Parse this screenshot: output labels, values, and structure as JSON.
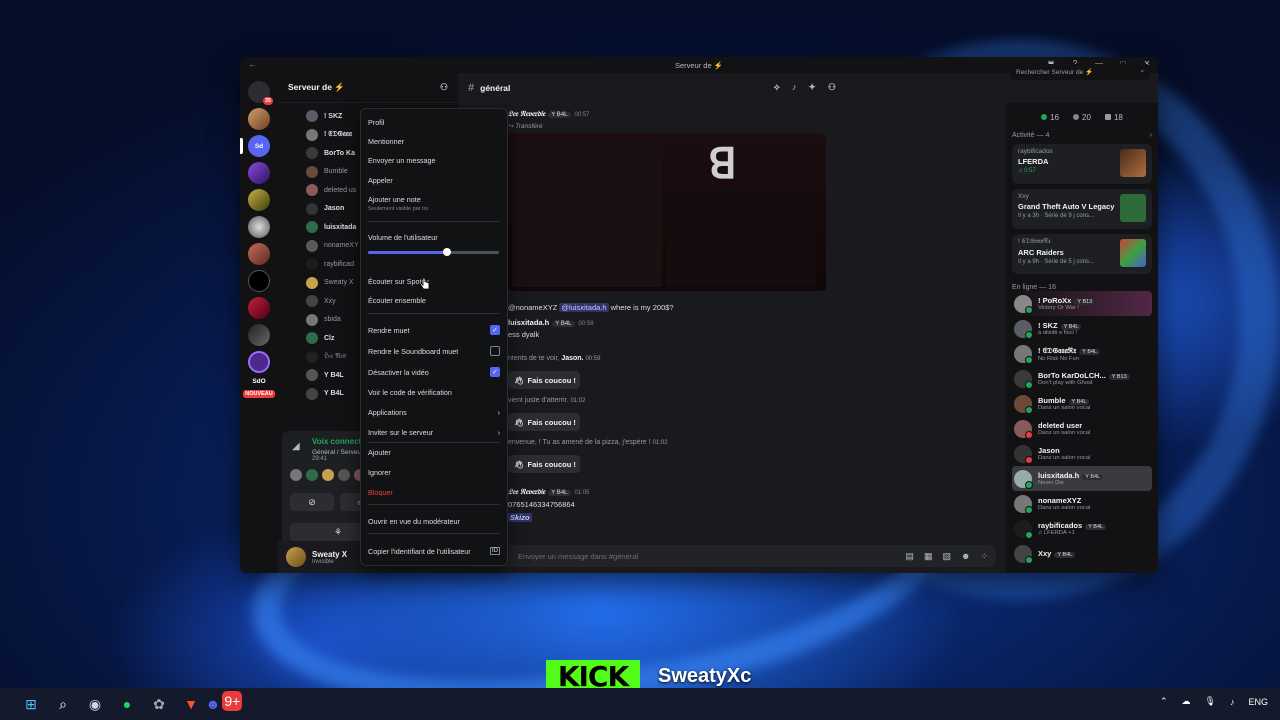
{
  "window": {
    "title": "Serveur de ⚡"
  },
  "server_rail": {
    "badges": [
      "35",
      "",
      "",
      "",
      "",
      "",
      "",
      "",
      "",
      "",
      "",
      ""
    ],
    "label": "SdO",
    "new": "NOUVEAU"
  },
  "sidebar": {
    "server_name": "Serveur de ⚡",
    "voice_users": [
      "! SKZ",
      "! 𝔈𝔇𝔊𝔞𝔞𝔞",
      "BorTo Ka",
      "Bumble",
      "deleted us",
      "Jason",
      "luisxitada",
      "nonameXY",
      "raybificad",
      "Sweaty X",
      "Xxy",
      "sbida",
      "Clz",
      "𝔏𝔢𝔢 𝔑𝔢𝔳",
      "Y B4L",
      "Y B4L"
    ],
    "voice_panel": {
      "title": "Voix connectée",
      "sub": "Général / Serveur de ⚡",
      "time": "29:41"
    },
    "user": {
      "name": "Sweaty X",
      "status": "Invisible"
    }
  },
  "chat": {
    "channel": "général",
    "search_placeholder": "Rechercher Serveur de ⚡",
    "messages": {
      "m1_author": "𝔏𝔢𝔢 𝔑𝔢𝔳𝔢𝔯𝔡𝔦𝔢",
      "m1_tag": "Y B4L",
      "m1_time": "00:57",
      "m1_forward": "↪ Transféré",
      "m2_prefix": "@nonameXYZ",
      "m2_mention": "@luisxitada.h",
      "m2_text": "where is my 200$?",
      "m3_author": "luisxitada.h",
      "m3_tag": "Y B4L",
      "m3_time": "00:58",
      "m3_text": "ess dyalk",
      "s1_text": "ntents de te voir,",
      "s1_name": "Jason.",
      "s1_time": "00:59",
      "wave": "Fais coucou !",
      "s2_text": "vient juste d'atterrir.",
      "s2_time": "01:02",
      "s3_text": "envenue, ! Tu as amené de la pizza, j'espère ! ",
      "s3_time": "01:02",
      "m4_author": "𝔏𝔢𝔢 𝔑𝔢𝔳𝔢𝔯𝔡𝔦𝔢",
      "m4_tag": "Y B4L",
      "m4_time": "01:05",
      "m4_text": "07651463347568​64",
      "m4_mention": "Skizo"
    },
    "composer_placeholder": "Envoyer un message dans #général"
  },
  "members": {
    "counts": [
      "16",
      "20",
      "18"
    ],
    "activity_title": "Activité — 4",
    "activities": [
      {
        "who": "raybificados",
        "game": "LFERDA",
        "meta": "♫ 0:57"
      },
      {
        "who": "Xxy",
        "game": "Grand Theft Auto V Legacy",
        "meta": "Il y a 3h · Série de 9 j cons..."
      },
      {
        "who": "! 𝔈𝔇𝔊𝔞𝔞𝔞ℜ𝔵",
        "game": "ARC Raiders",
        "meta": "Il y a 9h · Série de 5 j cons..."
      }
    ],
    "online_title": "En ligne — 16",
    "online": [
      {
        "name": "! PoRoXx",
        "tag": "Y B13",
        "status": "Victory Or War !"
      },
      {
        "name": "! SKZ",
        "tag": "Y B4L",
        "status": "à ɑlisitti e fisci !"
      },
      {
        "name": "! 𝔈𝔇𝔊𝔞𝔞𝔞ℜ𝔵",
        "tag": "Y B4L",
        "status": "No Risk No Fun"
      },
      {
        "name": "BorTo KarDoLCH...",
        "tag": "Y B13",
        "status": "Don't play with Ghost"
      },
      {
        "name": "Bumble",
        "tag": "Y B4L",
        "status": "Dans un salon vocal"
      },
      {
        "name": "deleted user",
        "tag": "",
        "status": "Dans un salon vocal"
      },
      {
        "name": "Jason",
        "tag": "",
        "status": "Dans un salon vocal"
      },
      {
        "name": "luisxitada.h",
        "tag": "Y B4L",
        "status": "Never Die"
      },
      {
        "name": "nonameXYZ",
        "tag": "",
        "status": "Dans un salon vocal"
      },
      {
        "name": "raybificados",
        "tag": "Y B4L",
        "status": "♫ LFERDA +1"
      },
      {
        "name": "Xxy",
        "tag": "Y B4L",
        "status": ""
      }
    ]
  },
  "context_menu": {
    "profile": "Profil",
    "mention": "Mentionner",
    "send_message": "Envoyer un message",
    "call": "Appeler",
    "add_note": "Ajouter une note",
    "note_sub": "Seulement visible par toi",
    "volume": "Volume de l'utilisateur",
    "volume_level": 0.6,
    "spotify": "Écouter sur Spotify",
    "listen_together": "Écouter ensemble",
    "mute": "Rendre muet",
    "soundboard_mute": "Rendre le Soundboard muet",
    "disable_video": "Désactiver la vidéo",
    "verify_code": "Voir le code de vérification",
    "apps": "Applications",
    "invite": "Inviter sur le serveur",
    "add": "Ajouter",
    "ignore": "Ignorer",
    "block": "Bloquer",
    "moderator_view": "Ouvrir en vue du modérateur",
    "copy_id": "Copier l'identifiant de l'utilisateur"
  },
  "overlay": {
    "kick_logo": "KICK",
    "streamer": "SweatyXc"
  },
  "taskbar": {
    "lang": "ENG",
    "discord_badge": "9+"
  }
}
